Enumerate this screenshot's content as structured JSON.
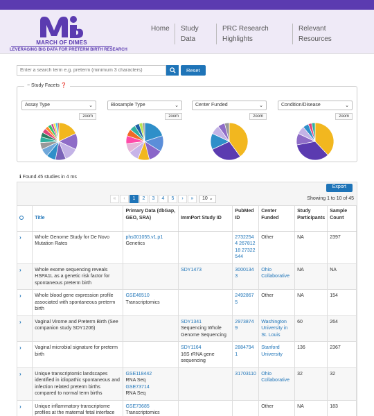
{
  "brand": {
    "name": "MARCH OF DIMES",
    "tagline": "LEVERAGING BIG DATA FOR PRETERM BIRTH RESEARCH",
    "color": "#5b3bb0"
  },
  "nav": {
    "home": "Home",
    "study_line1": "Study",
    "study_line2": "Data",
    "prc_line1": "PRC Research",
    "prc_line2": "Highlights",
    "res_line1": "Relevant",
    "res_line2": "Resources"
  },
  "search": {
    "placeholder": "Enter a search term e.g. preterm (minimum 3 characters)",
    "icon": "search-icon",
    "reset_label": "Reset"
  },
  "facets": {
    "title": "Study Facets",
    "items": [
      {
        "label": "Assay Type",
        "zoom": "zoom"
      },
      {
        "label": "Biosample Type",
        "zoom": "zoom"
      },
      {
        "label": "Center Funded",
        "zoom": "zoom"
      },
      {
        "label": "Condition/Disease",
        "zoom": "zoom"
      }
    ]
  },
  "chart_data": [
    {
      "type": "pie",
      "values": [
        18,
        14,
        12,
        9,
        8,
        7,
        6,
        5,
        4,
        4,
        3,
        3,
        2,
        2,
        2,
        1
      ],
      "colors": [
        "#f2b71f",
        "#8e6cc7",
        "#c3b3e6",
        "#7a63b8",
        "#2f8fc9",
        "#6fa7d9",
        "#999999",
        "#30b0a0",
        "#2b7c5f",
        "#e0457b",
        "#ff8a2b",
        "#33c16a",
        "#c23a8e",
        "#f4e04d",
        "#49c0e8",
        "#a03030"
      ]
    },
    {
      "type": "pie",
      "values": [
        20,
        14,
        12,
        10,
        9,
        8,
        7,
        6,
        5,
        4,
        3,
        2
      ],
      "colors": [
        "#2f8fc9",
        "#5b8ed9",
        "#8a66c9",
        "#f2b71f",
        "#c8b4e8",
        "#e4b6d8",
        "#ff4aa8",
        "#f06a24",
        "#30b0a0",
        "#1e5fa5",
        "#b7e54d",
        "#999999"
      ]
    },
    {
      "type": "pie",
      "values": [
        40,
        28,
        14,
        8,
        6,
        4
      ],
      "colors": [
        "#f2b71f",
        "#5b3bb0",
        "#2f8fc9",
        "#c3b3e6",
        "#8e6cc7",
        "#999999"
      ]
    },
    {
      "type": "pie",
      "values": [
        38,
        34,
        10,
        7,
        5,
        3,
        3
      ],
      "colors": [
        "#f2b71f",
        "#5b3bb0",
        "#8e6cc7",
        "#c3b3e6",
        "#2f8fc9",
        "#e0457b",
        "#30b0a0"
      ]
    }
  ],
  "found": "Found 45 studies in 4 ms",
  "table": {
    "export_label": "Export",
    "pager": [
      "«",
      "‹",
      "1",
      "2",
      "3",
      "4",
      "5",
      "›",
      "»"
    ],
    "page_size": "10",
    "showing": "Showing 1 to 10 of 45",
    "headers": {
      "title": "Title",
      "primary": "Primary Data (dbGap, GEO, SRA)",
      "immport": "ImmPort Study ID",
      "pubmed": "PubMed ID",
      "center": "Center Funded",
      "participants": "Study Participants",
      "sample": "Sample Count"
    },
    "rows": [
      {
        "title": "Whole Genome Study for De Novo Mutation Rates",
        "primary_link": "phs001055.v1.p1",
        "primary_extra": "Genetics",
        "immport": "",
        "immport_extra": "",
        "pubmed": "27322544 26781218 27322544",
        "center": "Other",
        "center_link": false,
        "participants": "NA",
        "sample": "2397"
      },
      {
        "title": "Whole exome sequencing reveals HSPA1L as a genetic risk factor for spontaneous preterm birth",
        "primary_link": "",
        "primary_extra": "",
        "immport": "SDY1473",
        "immport_extra": "",
        "pubmed": "30001343",
        "center": "Ohio Collaborative",
        "center_link": true,
        "participants": "NA",
        "sample": "NA"
      },
      {
        "title": "Whole blood gene expression profile associated with spontaneous preterm birth",
        "primary_link": "GSE46510",
        "primary_extra": "Transcriptomics",
        "immport": "",
        "immport_extra": "",
        "pubmed": "24928675",
        "center": "Other",
        "center_link": false,
        "participants": "NA",
        "sample": "154"
      },
      {
        "title": "Vaginal Virome and Preterm Birth (See companion study SDY1206)",
        "primary_link": "",
        "primary_extra": "",
        "immport": "SDY1341",
        "immport_extra": "Sequencing Whole Genome Sequencing",
        "pubmed": "29738749",
        "center": "Washington University in St. Louis",
        "center_link": true,
        "participants": "60",
        "sample": "264"
      },
      {
        "title": "Vaginal microbial signature for preterm birth",
        "primary_link": "",
        "primary_extra": "",
        "immport": "SDY1164",
        "immport_extra": "16S rRNA gene sequencing",
        "pubmed": "28847941",
        "center": "Stanford University",
        "center_link": true,
        "participants": "136",
        "sample": "2367"
      },
      {
        "title": "Unique transcriptomic landscapes identified in idiopathic spontaneous and infection related preterm births compared to normal term births",
        "primary_link": "GSE118442",
        "primary_extra": "RNA Seq",
        "primary_link2": "GSE73714",
        "primary_extra2": "RNA Seq",
        "immport": "",
        "immport_extra": "",
        "pubmed": "31703110",
        "center": "Ohio Collaborative",
        "center_link": true,
        "participants": "32",
        "sample": "32"
      },
      {
        "title": "Unique inflammatory transcriptome profiles at the maternal fetal interface",
        "primary_link": "GSE73685",
        "primary_extra": "Transcriptomics",
        "immport": "",
        "immport_extra": "",
        "pubmed": "",
        "center": "Other",
        "center_link": false,
        "participants": "NA",
        "sample": "183"
      }
    ]
  }
}
